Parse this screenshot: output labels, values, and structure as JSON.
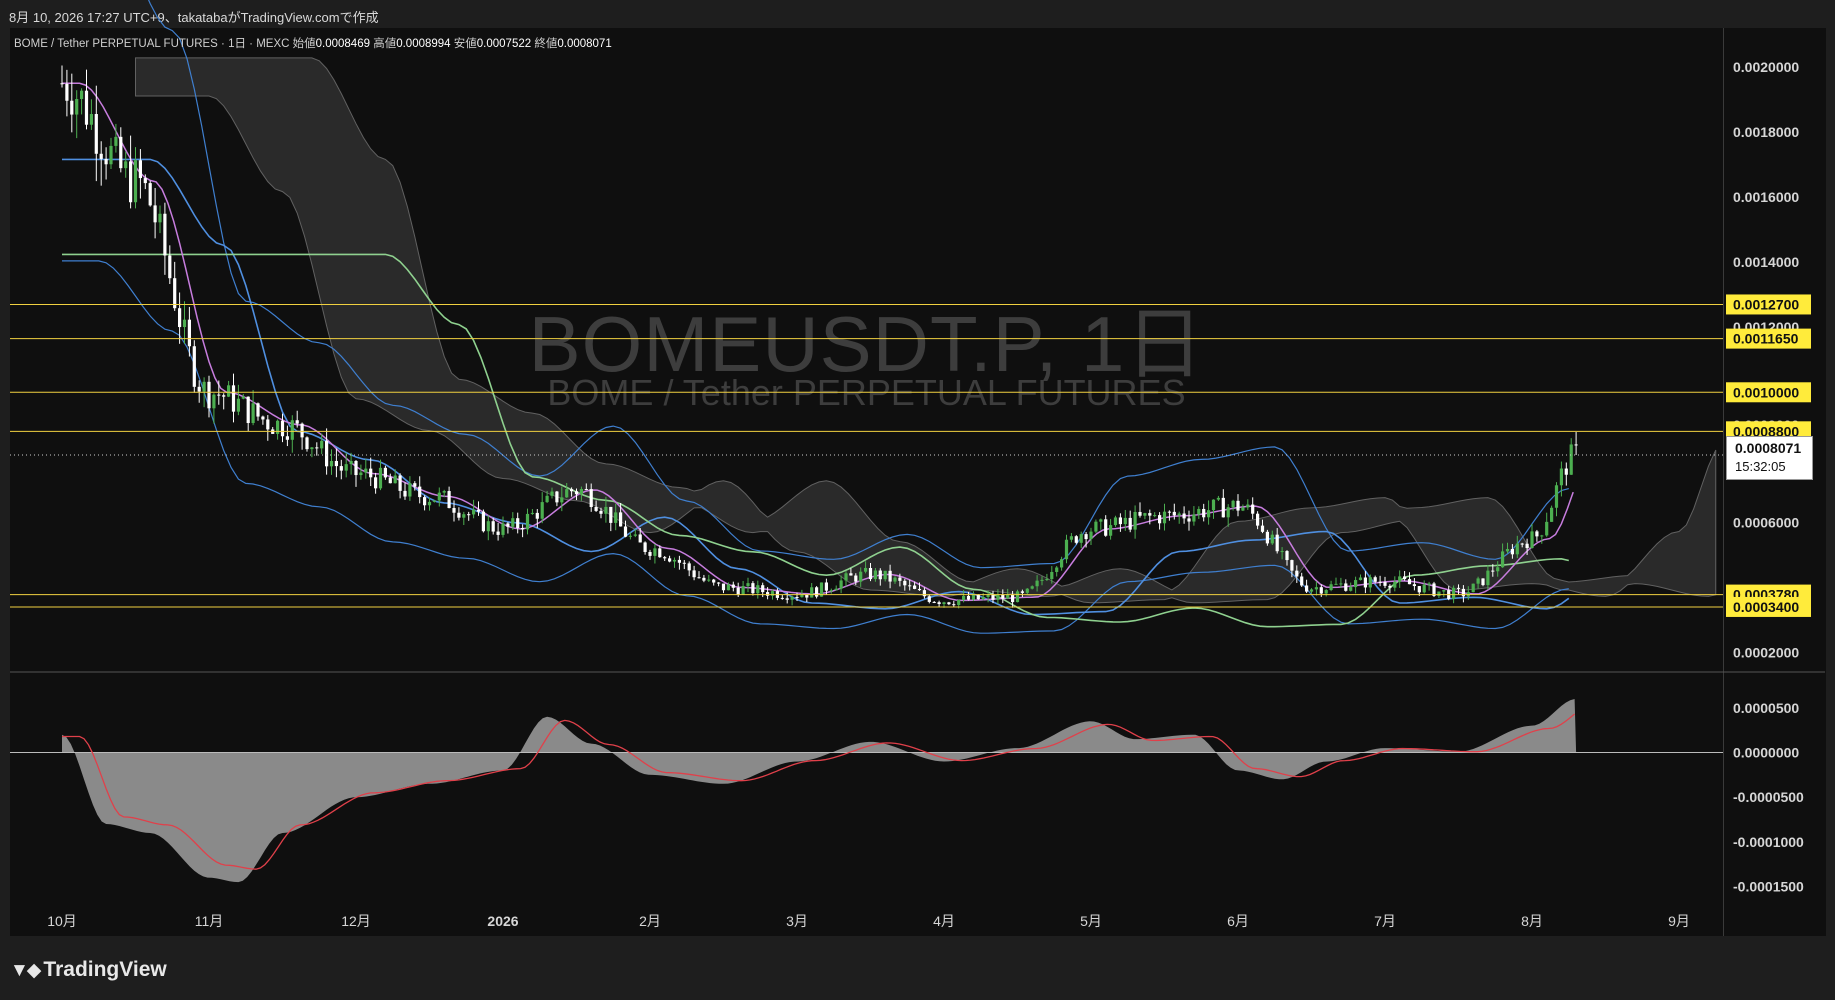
{
  "header": {
    "attribution": "8月 10, 2026 17:27 UTC+9、takatabaがTradingView.comで作成"
  },
  "legend": {
    "symbol_line": "BOME / Tether PERPETUAL FUTURES · 1日 · MEXC",
    "open_label": "始値",
    "open": "0.0008469",
    "high_label": "高値",
    "high": "0.0008994",
    "low_label": "安値",
    "low": "0.0007522",
    "close_label": "終値",
    "close": "0.0008071"
  },
  "watermark": {
    "line1": "BOMEUSDT.P, 1日",
    "line2": "BOME / Tether PERPETUAL FUTURES"
  },
  "current_price": {
    "price": "0.0008071",
    "countdown": "15:32:05"
  },
  "brand": {
    "name": "TradingView"
  },
  "colors": {
    "background": "#0f0f0f",
    "up_candle": "#4caf50",
    "down_candle": "#ffffff",
    "level_line": "#f0d040",
    "level_label_bg": "#ffeb3b",
    "ma_fast": "#c77dde",
    "ma_mid": "#4f8fe0",
    "ma_slow": "#8fd18f",
    "bollinger": "#3f7fcf",
    "cloud": "#2e2e2e",
    "macd_hist": "#8a8a8a",
    "macd_signal": "#e0404a"
  },
  "chart_data": [
    {
      "type": "candlestick",
      "name": "BOMEUSDT.P 1D",
      "x_ticks": [
        "10月",
        "11月",
        "12月",
        "2026",
        "2月",
        "3月",
        "4月",
        "5月",
        "6月",
        "7月",
        "8月",
        "9月"
      ],
      "x_ticks_bold": [
        "2026"
      ],
      "ylim": [
        0.00014,
        0.00212
      ],
      "y_ticks": [
        "0.0020000",
        "0.0018000",
        "0.0016000",
        "0.0014000",
        "0.0012000",
        "0.0009000",
        "0.0006000",
        "0.0002000"
      ],
      "y_tick_values": [
        0.002,
        0.0018,
        0.0016,
        0.0014,
        0.0012,
        0.0009,
        0.0006,
        0.0002
      ],
      "horizontal_levels": [
        {
          "label": "0.0012700",
          "value": 0.00127
        },
        {
          "label": "0.0011650",
          "value": 0.001165
        },
        {
          "label": "0.0010000",
          "value": 0.001
        },
        {
          "label": "0.0008800",
          "value": 0.00088
        },
        {
          "label": "0.0003780",
          "value": 0.000378
        },
        {
          "label": "0.0003400",
          "value": 0.00034
        }
      ],
      "current_price": 0.0008071,
      "price_path": {
        "months": [
          0,
          0.5,
          1.0,
          1.5,
          2.0,
          2.5,
          3.0,
          3.5,
          4.0,
          4.5,
          5.0,
          5.5,
          6.0,
          6.5,
          7.0,
          7.5,
          8.0,
          8.5,
          9.0,
          9.5,
          10.0,
          10.3
        ],
        "close": [
          0.00195,
          0.00165,
          0.001,
          0.0009,
          0.00075,
          0.00068,
          0.00058,
          0.0007,
          0.00052,
          0.0004,
          0.00038,
          0.00044,
          0.00036,
          0.00037,
          0.00058,
          0.00062,
          0.00065,
          0.0004,
          0.00042,
          0.00038,
          0.00055,
          0.00081
        ]
      },
      "indicators": [
        "Ichimoku cloud",
        "Bollinger Bands",
        "Moving averages (fast, mid, slow)"
      ]
    },
    {
      "type": "area",
      "name": "MACD",
      "y_ticks": [
        "0.0000500",
        "0.0000000",
        "-0.0000500",
        "-0.0001000",
        "-0.0001500"
      ],
      "y_tick_values": [
        5e-05,
        0,
        -5e-05,
        -0.0001,
        -0.00015
      ],
      "ylim": [
        -0.000165,
        7e-05
      ],
      "months": [
        0,
        0.3,
        0.6,
        1.0,
        1.2,
        1.5,
        2.0,
        2.5,
        3.0,
        3.3,
        3.6,
        4.0,
        4.5,
        5.0,
        5.5,
        6.0,
        6.5,
        7.0,
        7.3,
        7.7,
        8.0,
        8.3,
        8.6,
        9.0,
        9.5,
        10.0,
        10.3
      ],
      "values": [
        2e-05,
        -8e-05,
        -9e-05,
        -0.00014,
        -0.000145,
        -9e-05,
        -5e-05,
        -3.5e-05,
        -2e-05,
        4e-05,
        1e-05,
        -2.5e-05,
        -3.5e-05,
        -1e-05,
        1.2e-05,
        -1e-05,
        5e-06,
        3.5e-05,
        1.5e-05,
        2e-05,
        -2e-05,
        -3e-05,
        -1e-05,
        5e-06,
        1e-06,
        3e-05,
        6e-05
      ]
    }
  ]
}
